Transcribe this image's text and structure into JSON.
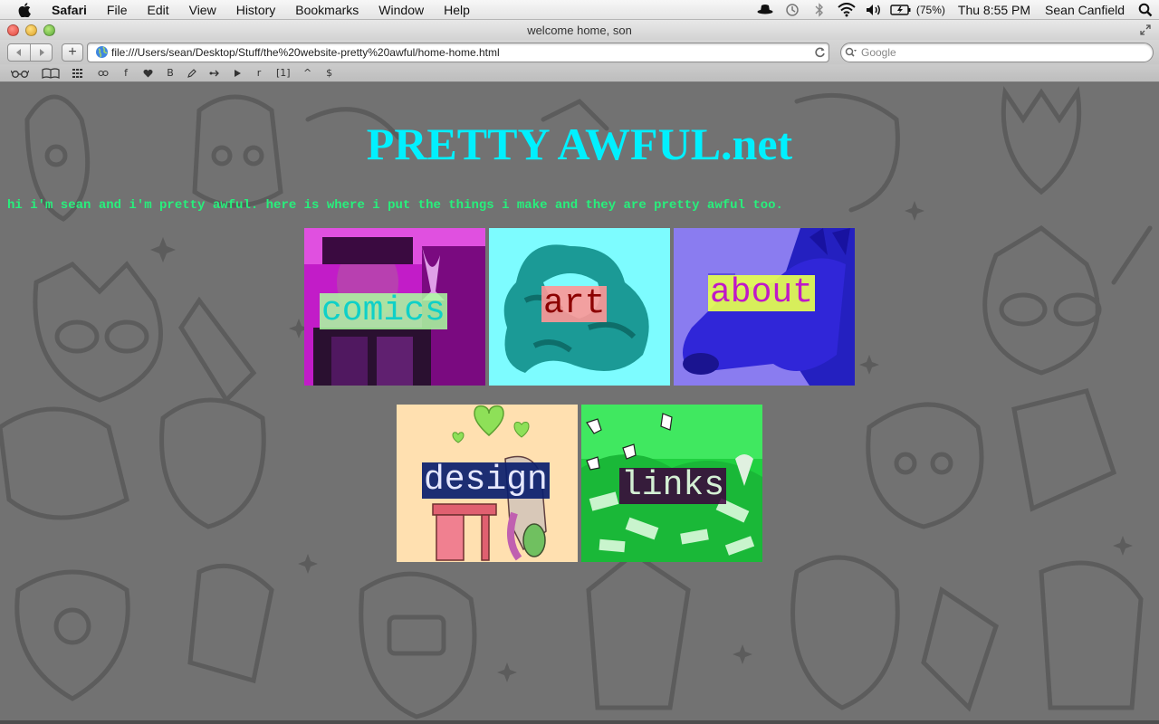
{
  "menubar": {
    "app": "Safari",
    "items": [
      "File",
      "Edit",
      "View",
      "History",
      "Bookmarks",
      "Window",
      "Help"
    ],
    "battery": "(75%)",
    "clock": "Thu 8:55 PM",
    "user": "Sean Canfield"
  },
  "window": {
    "title": "welcome home, son"
  },
  "toolbar": {
    "url": "file:///Users/sean/Desktop/Stuff/the%20website-pretty%20awful/home-home.html",
    "search_placeholder": "Google",
    "new_tab": "+"
  },
  "bookmarks": [
    "f",
    "B",
    "r",
    "[1]",
    "^",
    "$"
  ],
  "page": {
    "title": "PRETTY AWFUL.net",
    "intro": "hi i'm sean and i'm pretty awful. here is where i put the things i make and they are pretty awful too.",
    "tiles": [
      {
        "label": "comics"
      },
      {
        "label": "art"
      },
      {
        "label": "about"
      },
      {
        "label": "design"
      },
      {
        "label": "links"
      }
    ]
  }
}
